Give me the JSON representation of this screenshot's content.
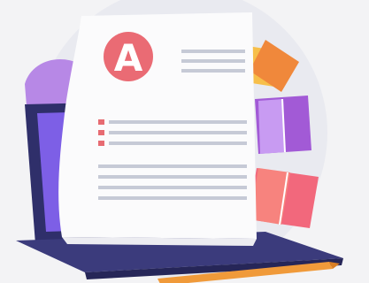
{
  "illustration": {
    "grade_letter": "A"
  },
  "colors": {
    "background": "#f3f3f5",
    "bg_circle": "#e9eaf0",
    "paper": "#fbfbfc",
    "paper_fold": "#ececf1",
    "text_line": "#c6cad6",
    "grade_badge": "#ea6b74",
    "grade_text": "#ffffff",
    "bullet": "#e76b72",
    "laptop_body": "#2f2f6a",
    "laptop_base": "#3b3b7c",
    "laptop_screen": "#7d5fe6",
    "pencil": "#f09a3a",
    "tile_yellow": "#f7bf4a",
    "tile_orange": "#f0883b",
    "tile_purple": "#a25ad6",
    "tile_violet": "#c89bf2",
    "tile_pink": "#f2687c",
    "tile_coral": "#f7837e",
    "blob": "#b788e6"
  }
}
